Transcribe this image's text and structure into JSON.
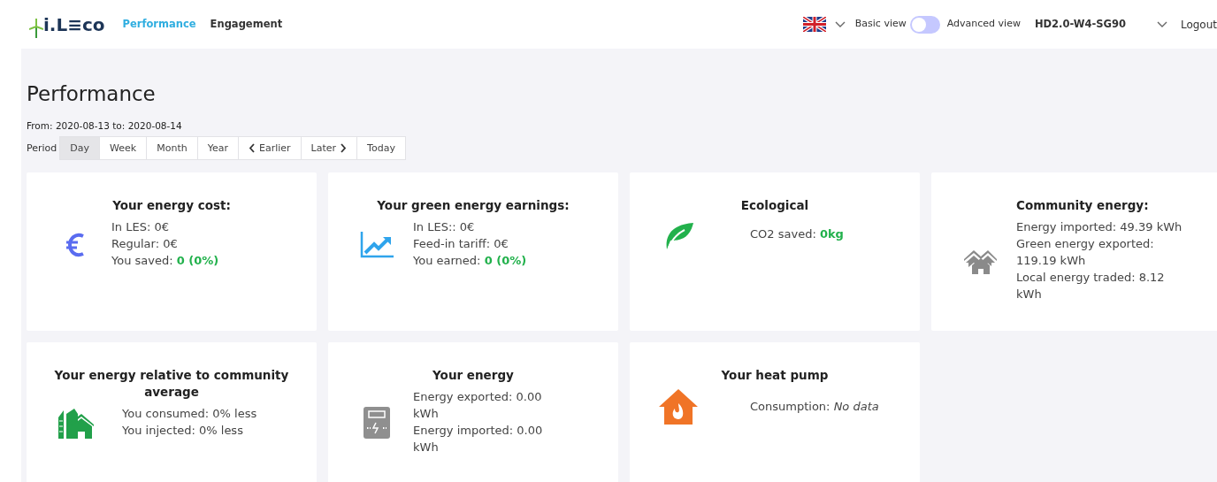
{
  "header": {
    "logo": "i.L≡co",
    "nav": [
      {
        "label": "Performance",
        "selected": true
      },
      {
        "label": "Engagement",
        "selected": false
      }
    ],
    "view_toggle": {
      "left_label": "Basic view",
      "right_label": "Advanced view",
      "on": false
    },
    "account": "HD2.0-W4-SG90",
    "logout": "Logout"
  },
  "page": {
    "title": "Performance",
    "range": "From: 2020-08-13 to: 2020-08-14",
    "period_label": "Period",
    "periods": [
      {
        "label": "Day",
        "kind": "plain",
        "selected": true
      },
      {
        "label": "Week",
        "kind": "plain",
        "selected": false
      },
      {
        "label": "Month",
        "kind": "plain",
        "selected": false
      },
      {
        "label": "Year",
        "kind": "plain",
        "selected": false
      },
      {
        "label": "Earlier",
        "kind": "prev",
        "selected": false
      },
      {
        "label": "Later",
        "kind": "next",
        "selected": false
      },
      {
        "label": "Today",
        "kind": "plain",
        "selected": false
      }
    ]
  },
  "cards": [
    {
      "title": "Your energy cost:",
      "kind": "euro",
      "lines": [
        {
          "text": "In LES: 0€"
        },
        {
          "text": "Regular: 0€"
        },
        {
          "text": "You saved: ",
          "highlight": "0 (0%)"
        }
      ]
    },
    {
      "title": "Your green energy earnings:",
      "kind": "chart",
      "lines": [
        {
          "text": "In LES:: 0€"
        },
        {
          "text": "Feed-in tariff: 0€"
        },
        {
          "text": "You earned: ",
          "highlight": "0 (0%)"
        }
      ]
    },
    {
      "title": "Ecological",
      "kind": "leaf",
      "lines": [
        {
          "text": "CO2 saved: ",
          "highlight": "0kg"
        }
      ]
    },
    {
      "title": "Community energy:",
      "kind": "houses",
      "lines": [
        {
          "text": "Energy imported: 49.39 kWh"
        },
        {
          "text": "Green energy exported: 119.19 kWh"
        },
        {
          "text": "Local energy traded: 8.12 kWh"
        }
      ]
    },
    {
      "title": "Your energy relative to community average",
      "kind": "town",
      "lines": [
        {
          "text": "You consumed: 0% less"
        },
        {
          "text": "You injected: 0% less"
        }
      ]
    },
    {
      "title": "Your energy",
      "kind": "meter",
      "lines": [
        {
          "text": "Energy exported: 0.00 kWh"
        },
        {
          "text": "Energy imported: 0.00 kWh"
        }
      ]
    },
    {
      "title": "Your heat pump",
      "kind": "heatpump",
      "lines": [
        {
          "text": "Consumption: *No data*"
        }
      ]
    }
  ]
}
